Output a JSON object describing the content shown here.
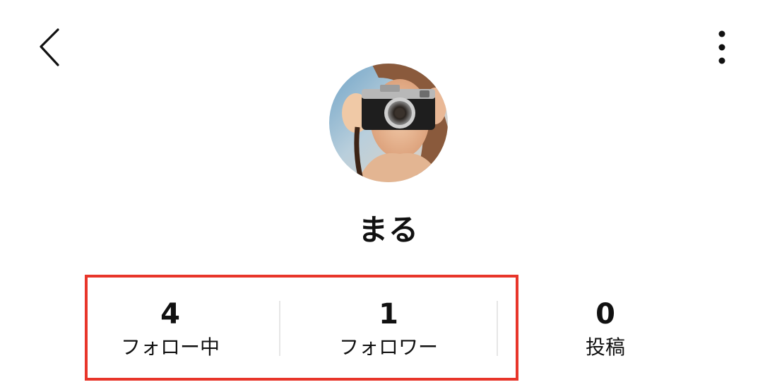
{
  "header": {
    "back_icon": "chevron-left-icon",
    "more_icon": "more-vertical-icon"
  },
  "profile": {
    "avatar_description": "person holding camera",
    "username": "まる"
  },
  "stats": [
    {
      "value": "4",
      "label": "フォロー中"
    },
    {
      "value": "1",
      "label": "フォロワー"
    },
    {
      "value": "0",
      "label": "投稿"
    }
  ],
  "colors": {
    "highlight_border": "#e8352a",
    "divider": "#e6e6e6",
    "text": "#111111"
  }
}
